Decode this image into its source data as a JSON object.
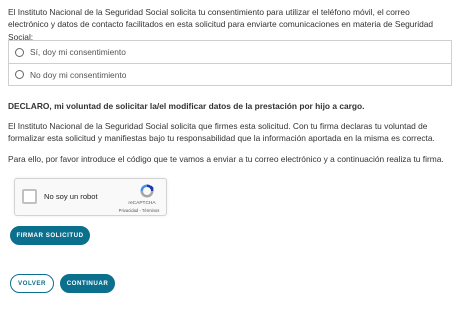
{
  "intro_text": "El Instituto Nacional de la Seguridad Social solicita tu consentimiento para utilizar el teléfono móvil, el correo electrónico y datos de contacto facilitados en esta solicitud para enviarte comunicaciones en materia de Seguridad Social:",
  "consent": {
    "option_yes": "Sí, doy mi consentimiento",
    "option_no": "No doy mi consentimiento"
  },
  "declaration": "DECLARO, mi voluntad de solicitar la/el modificar datos de la prestación por hijo a cargo.",
  "sign_text": "El Instituto Nacional de la Seguridad Social solicita que firmes esta solicitud. Con tu firma declaras tu voluntad de formalizar esta solicitud y manifiestas bajo tu responsabilidad que la información aportada en la misma es correcta.",
  "code_text": "Para ello, por favor introduce el código que te vamos a enviar a tu correo electrónico y a continuación realiza tu firma.",
  "captcha": {
    "label": "No soy un robot",
    "brand": "reCAPTCHA",
    "links": "Privacidad - Términos",
    "logo_icon": "recaptcha-logo-icon"
  },
  "buttons": {
    "sign": "FIRMAR SOLICITUD",
    "back": "VOLVER",
    "continue": "CONTINUAR"
  },
  "colors": {
    "accent": "#0b6f8e",
    "border": "#cfcfcf",
    "text": "#333333"
  }
}
